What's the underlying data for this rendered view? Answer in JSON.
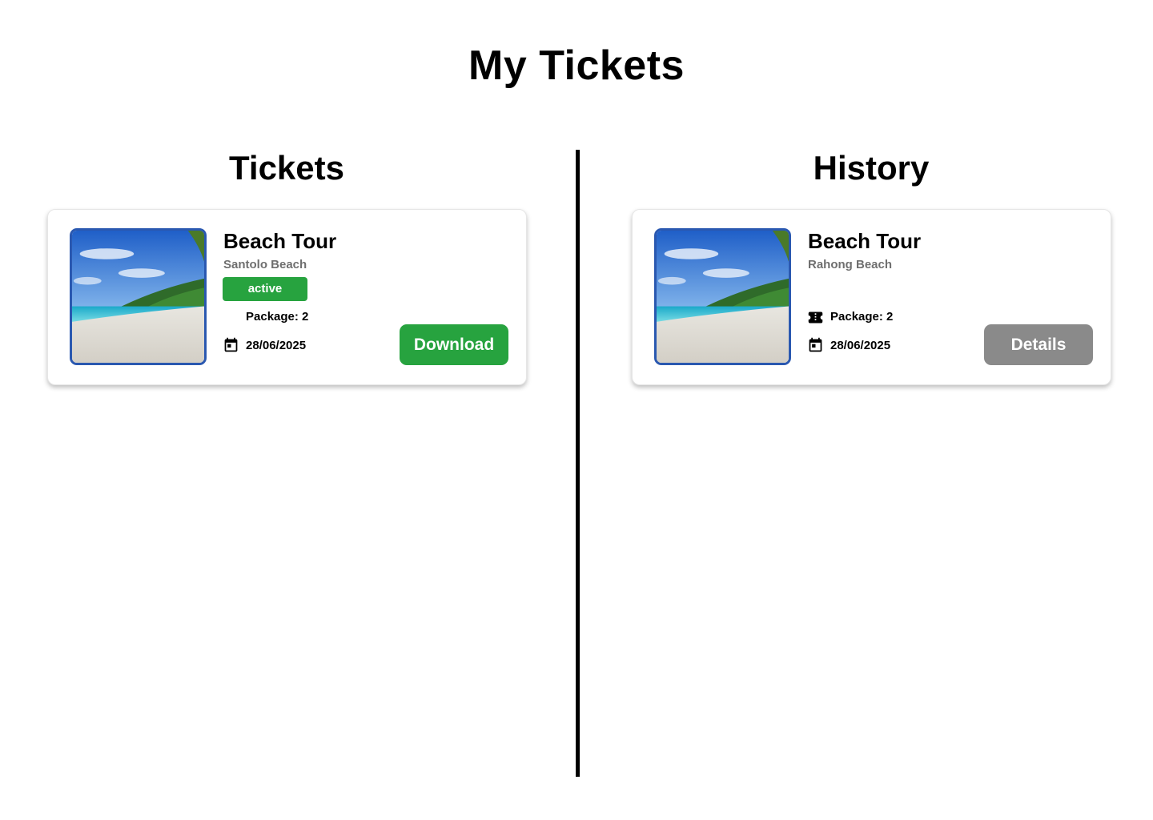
{
  "page": {
    "title": "My Tickets"
  },
  "tickets": {
    "heading": "Tickets",
    "card": {
      "title": "Beach Tour",
      "location": "Santolo Beach",
      "status": "active",
      "package": "Package: 2",
      "date": "28/06/2025",
      "action_label": "Download"
    }
  },
  "history": {
    "heading": "History",
    "card": {
      "title": "Beach Tour",
      "location": "Rahong Beach",
      "package": "Package: 2",
      "date": "28/06/2025",
      "action_label": "Details"
    }
  },
  "icons": {
    "calendar": "calendar-icon",
    "ticket": "ticket-icon"
  },
  "colors": {
    "accent_green": "#27a33f",
    "muted_gray": "#8a8a8a",
    "thumb_border": "#2a58b0"
  }
}
